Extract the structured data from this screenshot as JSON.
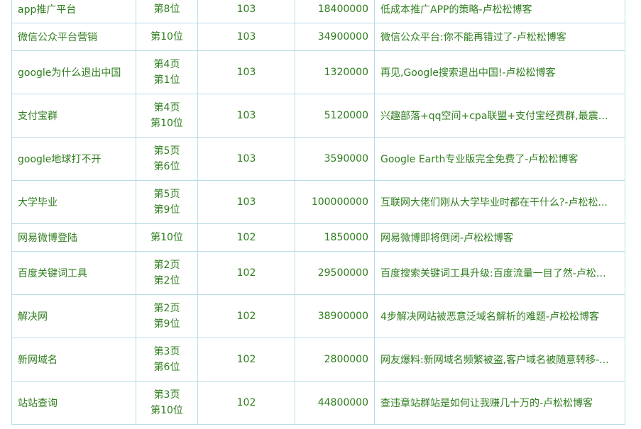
{
  "rows": [
    {
      "keyword": "app推广平台",
      "rank_page": "",
      "rank_pos": "第8位",
      "index": "103",
      "volume": "18400000",
      "title": "低成本推广APP的策略-卢松松博客"
    },
    {
      "keyword": "微信公众平台营销",
      "rank_page": "",
      "rank_pos": "第10位",
      "index": "103",
      "volume": "34900000",
      "title": "微信公众平台:你不能再错过了-卢松松博客"
    },
    {
      "keyword": "google为什么退出中国",
      "rank_page": "第4页",
      "rank_pos": "第1位",
      "index": "103",
      "volume": "1320000",
      "title": "再见,Google搜索退出中国!-卢松松博客"
    },
    {
      "keyword": "支付宝群",
      "rank_page": "第4页",
      "rank_pos": "第10位",
      "index": "103",
      "volume": "5120000",
      "title": "兴趣部落+qq空间+cpa联盟+支付宝经费群,最震撼..."
    },
    {
      "keyword": "google地球打不开",
      "rank_page": "第5页",
      "rank_pos": "第6位",
      "index": "103",
      "volume": "3590000",
      "title": "Google Earth专业版完全免费了-卢松松博客"
    },
    {
      "keyword": "大学毕业",
      "rank_page": "第5页",
      "rank_pos": "第9位",
      "index": "103",
      "volume": "100000000",
      "title": "互联网大佬们刚从大学毕业时都在干什么?-卢松松..."
    },
    {
      "keyword": "网易微博登陆",
      "rank_page": "",
      "rank_pos": "第10位",
      "index": "102",
      "volume": "1850000",
      "title": "网易微博即将倒闭-卢松松博客"
    },
    {
      "keyword": "百度关键词工具",
      "rank_page": "第2页",
      "rank_pos": "第2位",
      "index": "102",
      "volume": "29500000",
      "title": "百度搜索关键词工具升级:百度流量一目了然-卢松松..."
    },
    {
      "keyword": "解决网",
      "rank_page": "第2页",
      "rank_pos": "第9位",
      "index": "102",
      "volume": "38900000",
      "title": "4步解决网站被恶意泛域名解析的难题-卢松松博客"
    },
    {
      "keyword": "新网域名",
      "rank_page": "第3页",
      "rank_pos": "第6位",
      "index": "102",
      "volume": "2800000",
      "title": "网友爆料:新网域名频繁被盗,客户域名被随意转移-..."
    },
    {
      "keyword": "站站查询",
      "rank_page": "第3页",
      "rank_pos": "第10位",
      "index": "102",
      "volume": "44800000",
      "title": "查违章站群站是如何让我赚几十万的-卢松松博客"
    }
  ],
  "colors": {
    "text": "#2f7d1e",
    "border": "#b9dbe8",
    "background": "#ffffff"
  }
}
